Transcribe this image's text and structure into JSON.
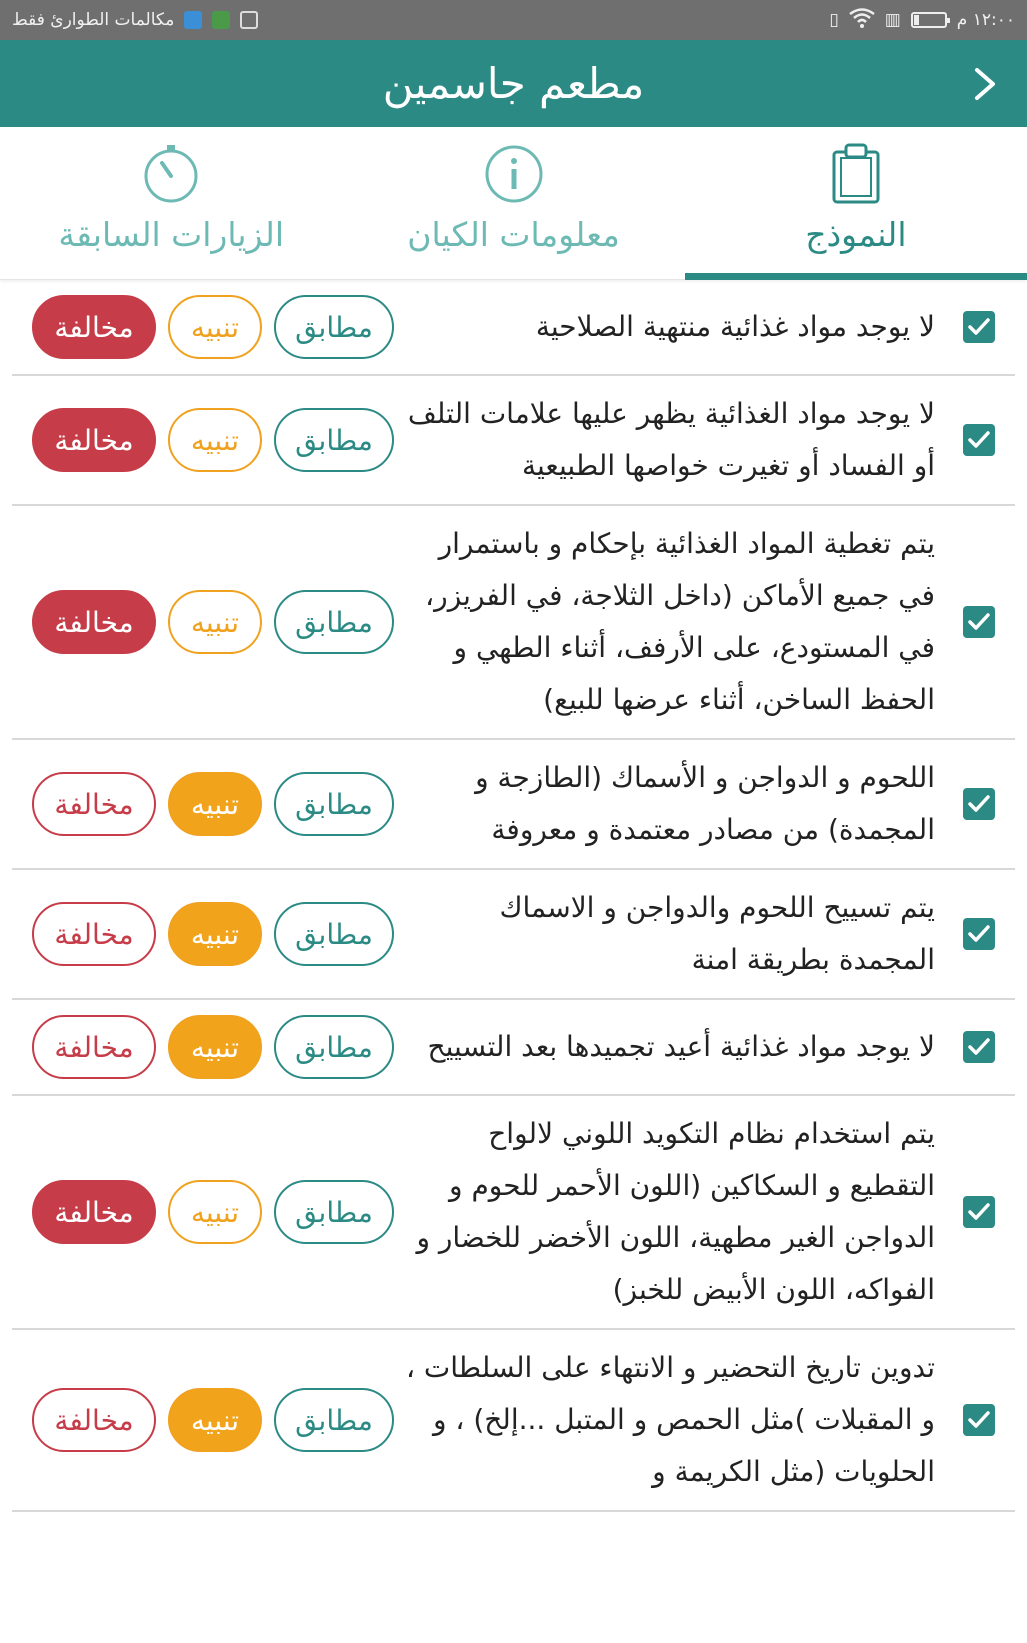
{
  "statusbar": {
    "time": "١٢:٠٠ م",
    "carrier": "مكالمات الطوارئ فقط",
    "battery_level": 0.15
  },
  "appbar": {
    "title": "مطعم جاسمين",
    "back_icon": "chevron-right-icon"
  },
  "tabs": [
    {
      "label": "النموذج",
      "icon": "clipboard-icon",
      "active": true
    },
    {
      "label": "معلومات الكيان",
      "icon": "info-icon",
      "active": false
    },
    {
      "label": "الزيارات السابقة",
      "icon": "stopwatch-icon",
      "active": false
    }
  ],
  "buttons": {
    "match": "مطابق",
    "warn": "تنبيه",
    "violation": "مخالفة"
  },
  "colors": {
    "primary": "#2c8a85",
    "warn": "#f2a31c",
    "violation": "#c63c48"
  },
  "items": [
    {
      "text": "لا يوجد مواد غذائية منتهية الصلاحية",
      "checked": true,
      "selected": "violation"
    },
    {
      "text": "لا يوجد مواد الغذائية يظهر عليها علامات التلف أو الفساد أو تغيرت خواصها الطبيعية",
      "checked": true,
      "selected": "violation"
    },
    {
      "text": "يتم تغطية المواد الغذائية بإحكام و باستمرار في جميع الأماكن (داخل الثلاجة، في الفريزر، في المستودع، على الأرفف، أثناء الطهي و الحفظ الساخن، أثناء عرضها للبيع)",
      "checked": true,
      "selected": "violation"
    },
    {
      "text": "اللحوم و الدواجن و الأسماك (الطازجة و المجمدة) من مصادر معتمدة و معروفة",
      "checked": true,
      "selected": "warn"
    },
    {
      "text": "يتم تسييح اللحوم والدواجن و الاسماك المجمدة بطريقة امنة",
      "checked": true,
      "selected": "warn"
    },
    {
      "text": "لا يوجد مواد غذائية أعيد تجميدها بعد التسييح",
      "checked": true,
      "selected": "warn"
    },
    {
      "text": "يتم استخدام نظام التكويد اللوني لالواح التقطيع و السكاكين (اللون الأحمر للحوم و الدواجن الغير مطهية، اللون الأخضر للخضار و الفواكه، اللون الأبيض للخبز)",
      "checked": true,
      "selected": "violation"
    },
    {
      "text": "تدوين تاريخ التحضير و الانتهاء على السلطات ، و المقبلات )مثل الحمص و المتبل ...إلخ) ، و الحلويات (مثل الكريمة و",
      "checked": true,
      "selected": "warn"
    }
  ]
}
